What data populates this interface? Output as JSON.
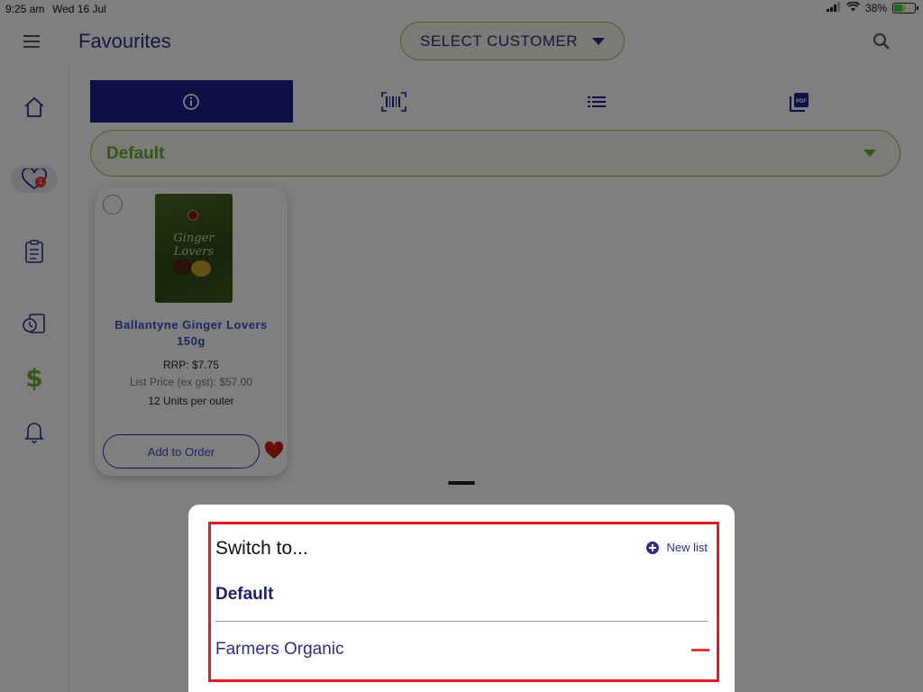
{
  "status_bar": {
    "time": "9:25 am",
    "date": "Wed 16 Jul",
    "battery": "38%"
  },
  "header": {
    "title": "Favourites",
    "customer_select": "SELECT CUSTOMER"
  },
  "sidebar": {
    "items": [
      {
        "name": "home",
        "icon": "home-icon"
      },
      {
        "name": "favourites",
        "icon": "heart-icon",
        "active": true,
        "badge": "1"
      },
      {
        "name": "orders",
        "icon": "clipboard-icon"
      },
      {
        "name": "history",
        "icon": "history-icon"
      },
      {
        "name": "pricing",
        "icon": "dollar-icon",
        "label": "$"
      },
      {
        "name": "notifications",
        "icon": "bell-icon"
      }
    ]
  },
  "tabs": [
    {
      "name": "info",
      "icon": "info-icon",
      "active": true
    },
    {
      "name": "barcode",
      "icon": "barcode-icon"
    },
    {
      "name": "list",
      "icon": "list-icon"
    },
    {
      "name": "pdf",
      "icon": "pdf-icon"
    }
  ],
  "list_selector": {
    "selected": "Default"
  },
  "product": {
    "name": "Ballantyne Ginger Lovers 150g",
    "image_text": "Ginger Lovers",
    "rrp": "RRP: $7.75",
    "list_price": "List Price (ex gst): $57.00",
    "units": "12 Units per outer",
    "add_button": "Add to Order"
  },
  "sheet": {
    "title": "Switch to...",
    "new_list": "New list",
    "lists": [
      {
        "name": "Default",
        "current": true
      },
      {
        "name": "Farmers Organic",
        "current": false
      }
    ]
  },
  "colors": {
    "brand_navy": "#1a1f8c",
    "brand_green": "#6cad2a",
    "highlight_red": "#e02020",
    "remove_red": "#e53935"
  }
}
